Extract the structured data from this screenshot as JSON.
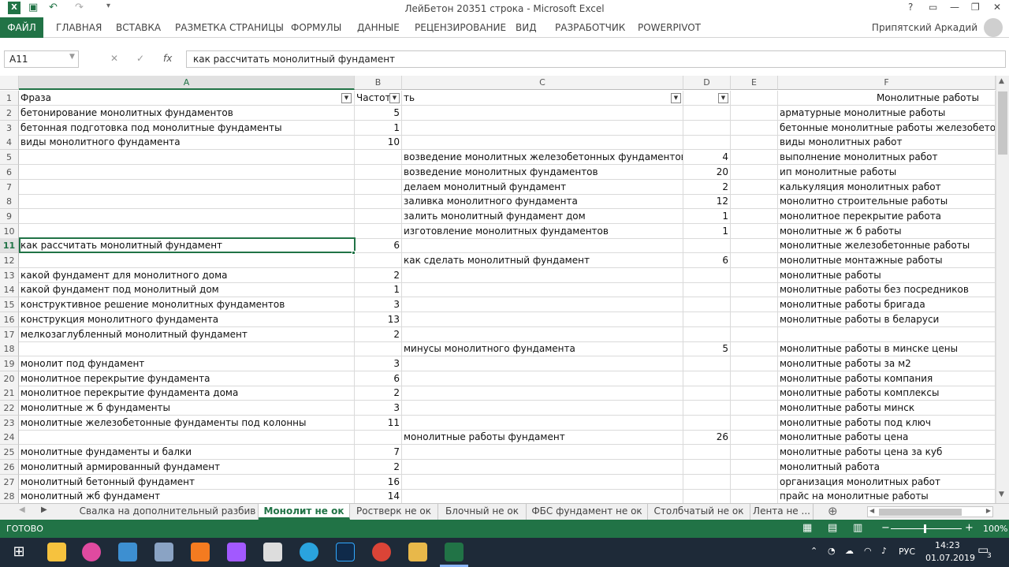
{
  "window": {
    "title": "ЛейБетон 20351 строка - Microsoft Excel",
    "user": "Припятский Аркадий",
    "help": "?"
  },
  "ribbon_tabs": [
    "ФАЙЛ",
    "ГЛАВНАЯ",
    "ВСТАВКА",
    "РАЗМЕТКА СТРАНИЦЫ",
    "ФОРМУЛЫ",
    "ДАННЫЕ",
    "РЕЦЕНЗИРОВАНИЕ",
    "ВИД",
    "РАЗРАБОТЧИК",
    "POWERPIVOT"
  ],
  "formula_bar": {
    "name_box": "A11",
    "fx": "fx",
    "content": "как рассчитать монолитный фундамент"
  },
  "columns": [
    "A",
    "B",
    "C",
    "D",
    "E",
    "F"
  ],
  "header_row": {
    "A": "Фраза",
    "B": "Частот",
    "C": "ть",
    "F": "Монолитные работы"
  },
  "rows": [
    {
      "n": "2",
      "A": "бетонирование монолитных фундаментов",
      "B": "5",
      "C": "",
      "D": "",
      "F": "арматурные монолитные работы"
    },
    {
      "n": "3",
      "A": "бетонная подготовка под монолитные фундаменты",
      "B": "1",
      "C": "",
      "D": "",
      "F": "бетонные монолитные работы железобетон"
    },
    {
      "n": "4",
      "A": "виды монолитного фундамента",
      "B": "10",
      "C": "",
      "D": "",
      "F": "виды монолитных работ"
    },
    {
      "n": "5",
      "A": "",
      "B": "",
      "C": "возведение монолитных железобетонных фундаментов",
      "D": "4",
      "F": "выполнение монолитных работ"
    },
    {
      "n": "6",
      "A": "",
      "B": "",
      "C": "возведение монолитных фундаментов",
      "D": "20",
      "F": "ип монолитные работы"
    },
    {
      "n": "7",
      "A": "",
      "B": "",
      "C": "делаем монолитный фундамент",
      "D": "2",
      "F": "калькуляция монолитных работ"
    },
    {
      "n": "8",
      "A": "",
      "B": "",
      "C": "заливка монолитного фундамента",
      "D": "12",
      "F": "монолитно строительные работы"
    },
    {
      "n": "9",
      "A": "",
      "B": "",
      "C": "залить монолитный фундамент дом",
      "D": "1",
      "F": "монолитное перекрытие работа"
    },
    {
      "n": "10",
      "A": "",
      "B": "",
      "C": "изготовление монолитных фундаментов",
      "D": "1",
      "F": "монолитные ж б работы"
    },
    {
      "n": "11",
      "A": "как рассчитать монолитный фундамент",
      "B": "6",
      "C": "",
      "D": "",
      "F": "монолитные железобетонные работы"
    },
    {
      "n": "12",
      "A": "",
      "B": "",
      "C": "как сделать монолитный фундамент",
      "D": "6",
      "F": "монолитные монтажные работы"
    },
    {
      "n": "13",
      "A": "какой фундамент для монолитного дома",
      "B": "2",
      "C": "",
      "D": "",
      "F": "монолитные работы"
    },
    {
      "n": "14",
      "A": "какой фундамент под монолитный дом",
      "B": "1",
      "C": "",
      "D": "",
      "F": "монолитные работы без посредников"
    },
    {
      "n": "15",
      "A": "конструктивное решение монолитных фундаментов",
      "B": "3",
      "C": "",
      "D": "",
      "F": "монолитные работы бригада"
    },
    {
      "n": "16",
      "A": "конструкция монолитного фундамента",
      "B": "13",
      "C": "",
      "D": "",
      "F": "монолитные работы в беларуси"
    },
    {
      "n": "17",
      "A": "мелкозаглубленный монолитный фундамент",
      "B": "2",
      "C": "",
      "D": "",
      "F": ""
    },
    {
      "n": "18",
      "A": "",
      "B": "",
      "C": "минусы монолитного фундамента",
      "D": "5",
      "F": "монолитные работы в минске цены"
    },
    {
      "n": "19",
      "A": "монолит под фундамент",
      "B": "3",
      "C": "",
      "D": "",
      "F": "монолитные работы за м2"
    },
    {
      "n": "20",
      "A": "монолитное перекрытие фундамента",
      "B": "6",
      "C": "",
      "D": "",
      "F": "монолитные работы компания"
    },
    {
      "n": "21",
      "A": "монолитное перекрытие фундамента дома",
      "B": "2",
      "C": "",
      "D": "",
      "F": "монолитные работы комплексы"
    },
    {
      "n": "22",
      "A": "монолитные ж б фундаменты",
      "B": "3",
      "C": "",
      "D": "",
      "F": "монолитные работы минск"
    },
    {
      "n": "23",
      "A": "монолитные железобетонные фундаменты под колонны",
      "B": "11",
      "C": "",
      "D": "",
      "F": "монолитные работы под ключ"
    },
    {
      "n": "24",
      "A": "",
      "B": "",
      "C": "монолитные работы фундамент",
      "D": "26",
      "F": "монолитные работы цена"
    },
    {
      "n": "25",
      "A": "монолитные фундаменты и балки",
      "B": "7",
      "C": "",
      "D": "",
      "F": "монолитные работы цена за куб"
    },
    {
      "n": "26",
      "A": "монолитный армированный фундамент",
      "B": "2",
      "C": "",
      "D": "",
      "F": "монолитный работа"
    },
    {
      "n": "27",
      "A": "монолитный бетонный фундамент",
      "B": "16",
      "C": "",
      "D": "",
      "F": "организация монолитных работ"
    },
    {
      "n": "28",
      "A": "монолитный жб фундамент",
      "B": "14",
      "C": "",
      "D": "",
      "F": "прайс на монолитные работы"
    }
  ],
  "sheet_tabs": [
    "Свалка на дополнительный разбив",
    "Монолит не ок",
    "Ростверк не ок",
    "Блочный не ок",
    "ФБС фундамент не ок",
    "Столбчатый не ок",
    "Лента не ..."
  ],
  "active_sheet": "Монолит не ок",
  "status": {
    "state": "ГОТОВО",
    "zoom": "100%"
  },
  "taskbar": {
    "lang": "РУС",
    "time": "14:23",
    "date": "01.07.2019",
    "notifications": "3"
  }
}
